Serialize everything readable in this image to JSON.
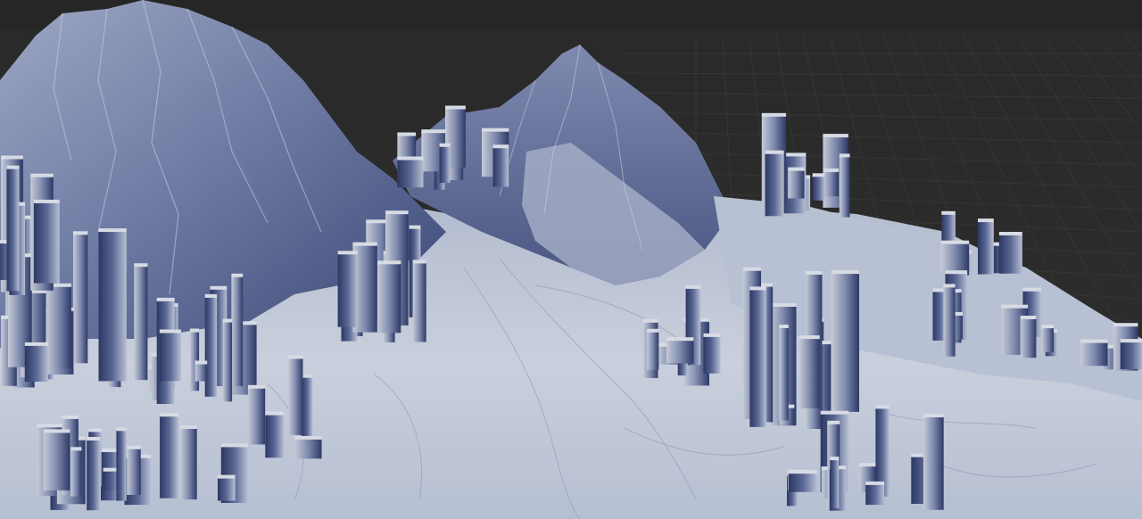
{
  "viewport": {
    "background_color": "#2b2b2b",
    "topbar_color": "#262626",
    "grid_color": "#3a3a3a",
    "terrain_light": "#c9cfdc",
    "terrain_mid": "#8d98b6",
    "terrain_dark": "#2f3b67"
  }
}
